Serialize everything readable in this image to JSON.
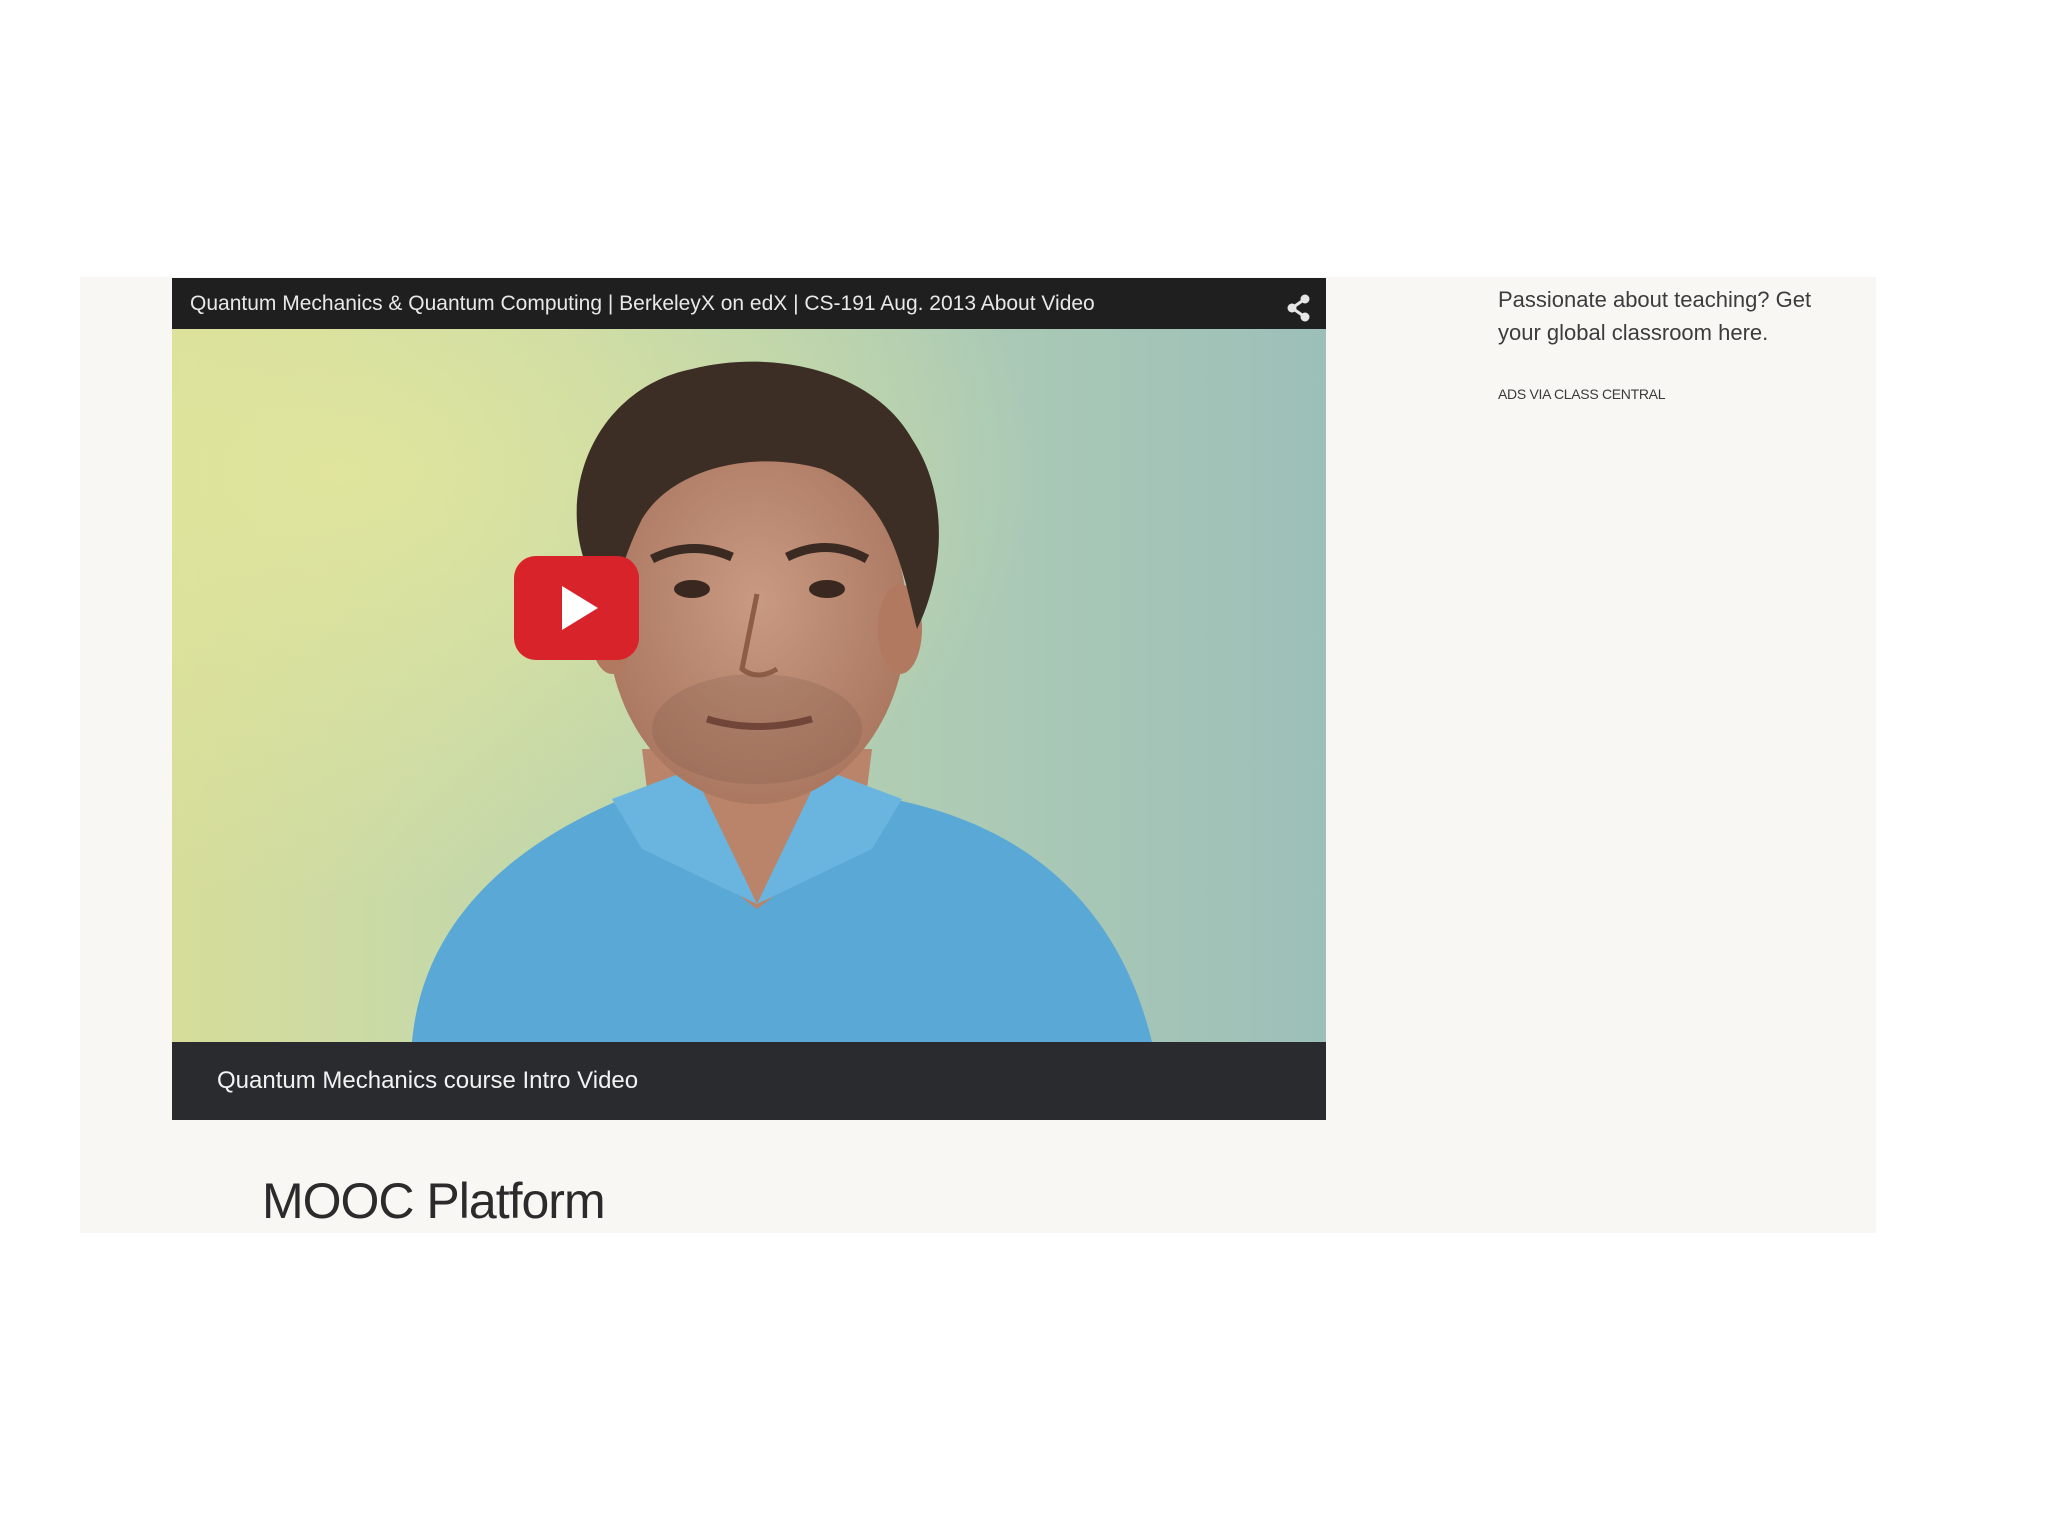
{
  "video": {
    "title": "Quantum Mechanics & Quantum Computing | BerkeleyX on edX | CS-191 Aug. 2013 About Video",
    "caption": "Quantum Mechanics course Intro Video",
    "icons": {
      "share": "share-icon",
      "play": "play-icon"
    },
    "colors": {
      "play_button": "#d8232a",
      "title_bar": "#1f1f1f",
      "caption_bar": "#2a2b2e"
    }
  },
  "sidebar_ad": {
    "text": "Passionate about teaching? Get your global classroom here.",
    "attribution": "ADS VIA CLASS CENTRAL"
  },
  "section": {
    "heading": "MOOC Platform"
  }
}
